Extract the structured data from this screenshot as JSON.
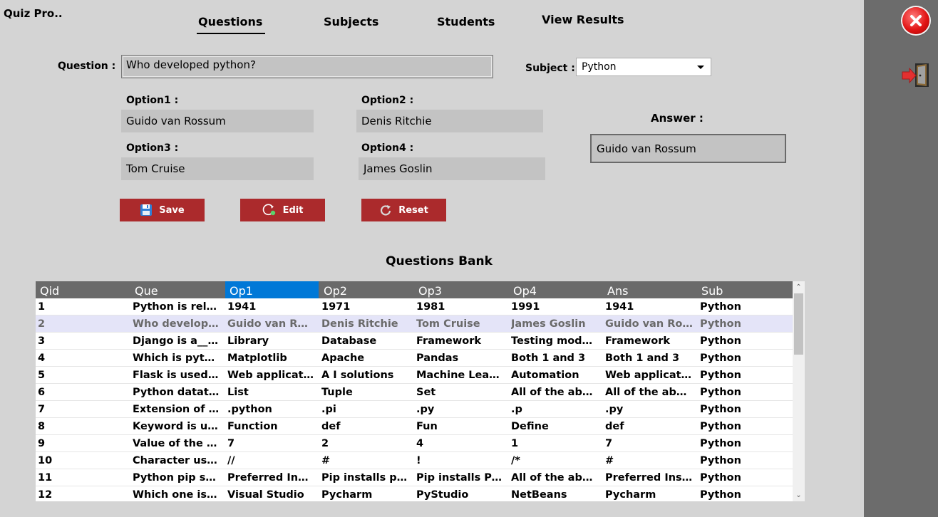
{
  "app": {
    "title": "Quiz Pro.."
  },
  "nav": {
    "tabs": [
      "Questions",
      "Subjects",
      "Students",
      "View Results"
    ],
    "active": "Questions"
  },
  "form": {
    "question_label": "Question :",
    "question_value": "Who developed python?",
    "subject_label": "Subject :",
    "subject_value": "Python",
    "option1_label": "Option1 :",
    "option1_value": "Guido van Rossum",
    "option2_label": "Option2 :",
    "option2_value": "Denis Ritchie",
    "option3_label": "Option3 :",
    "option3_value": "Tom Cruise",
    "option4_label": "Option4 :",
    "option4_value": "James Goslin",
    "answer_label": "Answer :",
    "answer_value": "Guido van Rossum"
  },
  "buttons": {
    "save": "Save",
    "edit": "Edit",
    "reset": "Reset"
  },
  "bank": {
    "title": "Questions Bank",
    "columns": [
      "Qid",
      "Que",
      "Op1",
      "Op2",
      "Op3",
      "Op4",
      "Ans",
      "Sub"
    ],
    "selected_column": "Op1",
    "selected_row": 1,
    "rows": [
      [
        "1",
        "Python is relas...",
        "1941",
        "1971",
        "1981",
        "1991",
        "1941",
        "Python"
      ],
      [
        "2",
        "Who develope...",
        "Guido van Ros...",
        "Denis Ritchie",
        "Tom Cruise",
        "James Goslin",
        "Guido van Ross...",
        "Python"
      ],
      [
        "3",
        "Django is a____.",
        "Library",
        "Database",
        "Framework",
        "Testing module",
        "Framework",
        "Python"
      ],
      [
        "4",
        "Which is pytho...",
        "Matplotlib",
        "Apache",
        "Pandas",
        "Both 1 and 3",
        "Both 1 and 3",
        "Python"
      ],
      [
        "5",
        "Flask is used for-",
        "Web applicatio...",
        "A I solutions",
        "Machine Learni...",
        "Automation",
        "Web applicatio...",
        "Python"
      ],
      [
        "6",
        "Python datatyp...",
        "List",
        "Tuple",
        "Set",
        "All of the above",
        "All of the above",
        "Python"
      ],
      [
        "7",
        "Extension of p...",
        ".python",
        ".pi",
        ".py",
        ".p",
        ".py",
        "Python"
      ],
      [
        "8",
        "Keyword is use...",
        "Function",
        "def",
        "Fun",
        "Define",
        "def",
        "Python"
      ],
      [
        "9",
        "Value of the fol...",
        "7",
        "2",
        "4",
        "1",
        "7",
        "Python"
      ],
      [
        "10",
        "Character used...",
        "//",
        "#",
        "!",
        "/*",
        "#",
        "Python"
      ],
      [
        "11",
        "Python pip sta...",
        "Preferred Insta...",
        "Pip installs pyt...",
        "Pip installs Pac...",
        "All of the above",
        "Preferred Insta...",
        "Python"
      ],
      [
        "12",
        "Which one is p...",
        "Visual Studio",
        "Pycharm",
        "PyStudio",
        "NetBeans",
        "Pycharm",
        "Python"
      ]
    ]
  },
  "sidebar": {
    "icons": [
      "close-icon",
      "logout-door-icon"
    ]
  },
  "colors": {
    "accent": "#ab2a2c",
    "header": "#6a6a6a",
    "selected_header": "#0078d7",
    "selected_row": "#e4e4f8",
    "background": "#d4d4d4",
    "sidebar": "#6c6c6c"
  }
}
